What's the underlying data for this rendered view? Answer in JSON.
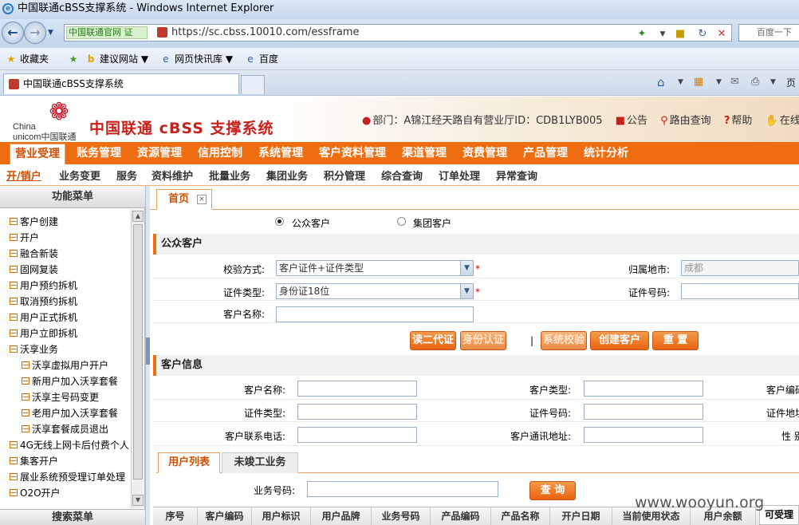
{
  "browser": {
    "window_title": "中国联通cBSS支撑系统 - Windows Internet Explorer",
    "site_tag": "中国联通官网 证",
    "url": "https://sc.cbss.10010.com/essframe",
    "search_placeholder": "百度一下",
    "favorites": {
      "favorites_label": "收藏夹",
      "suggested_sites": "建议网站",
      "web_slices": "网页快讯库",
      "baidu": "百度"
    },
    "tab_title": "中国联通cBSS支撑系统"
  },
  "app": {
    "system_title": "中国联通 cBSS 支撑系统",
    "logo_text_1": "China",
    "logo_text_2": "unicom中国联通",
    "user_info": {
      "dept": "部门：A锦江经天路自有营业厅ID：CDB1LYB005",
      "notice": "公告",
      "route_query": "路由查询",
      "help": "帮助",
      "online": "在线交"
    }
  },
  "main_menu": [
    "营业受理",
    "账务管理",
    "资源管理",
    "信用控制",
    "系统管理",
    "客户资料管理",
    "渠道管理",
    "资费管理",
    "产品管理",
    "统计分析"
  ],
  "sub_menu": [
    "开/销户",
    "业务变更",
    "服务",
    "资料维护",
    "批量业务",
    "集团业务",
    "积分管理",
    "综合查询",
    "订单处理",
    "异常查询"
  ],
  "left_panel": {
    "title": "功能菜单",
    "tree": [
      {
        "label": "客户创建",
        "level": 0
      },
      {
        "label": "开户",
        "level": 0
      },
      {
        "label": "融合新装",
        "level": 0
      },
      {
        "label": "固网复装",
        "level": 0
      },
      {
        "label": "用户预约拆机",
        "level": 0
      },
      {
        "label": "取消预约拆机",
        "level": 0
      },
      {
        "label": "用户正式拆机",
        "level": 0
      },
      {
        "label": "用户立即拆机",
        "level": 0
      },
      {
        "label": "沃享业务",
        "level": 0
      },
      {
        "label": "沃享虚拟用户开户",
        "level": 1
      },
      {
        "label": "新用户加入沃享套餐",
        "level": 1
      },
      {
        "label": "沃享主号码变更",
        "level": 1
      },
      {
        "label": "老用户加入沃享套餐",
        "level": 1
      },
      {
        "label": "沃享套餐成员退出",
        "level": 1
      },
      {
        "label": "4G无线上网卡后付费个人",
        "level": 0
      },
      {
        "label": "集客开户",
        "level": 0
      },
      {
        "label": "展业系统预受理订单处理",
        "level": 0
      },
      {
        "label": "O2O开户",
        "level": 0
      }
    ],
    "search_title": "搜索菜单"
  },
  "content": {
    "home_tab": "首页",
    "close_glyph": "×",
    "radios": {
      "public": "公众客户",
      "group": "集团客户"
    },
    "public_section": "公众客户",
    "verify_method_label": "校验方式:",
    "verify_method_value": "客户证件+证件类型",
    "region_label": "归属地市:",
    "region_value": "成都",
    "cert_type_label": "证件类型:",
    "cert_type_value": "身份证18位",
    "cert_no_label": "证件号码:",
    "cust_name_label": "客户名称:",
    "required_mark": "*",
    "buttons": {
      "read_id": "读二代证",
      "id_auth": "身份认证",
      "sys_verify": "系统校验",
      "create_cust": "创建客户",
      "reset": "重 置"
    },
    "cursor_mark": "|",
    "cust_info_section": "客户信息",
    "info_labels": {
      "cust_name": "客户名称:",
      "cust_type": "客户类型:",
      "cust_code": "客户编码",
      "cert_type": "证件类型:",
      "cert_no": "证件号码:",
      "cert_addr": "证件地址",
      "contact_phone": "客户联系电话:",
      "contact_addr": "客户通讯地址:",
      "gender": "性 别"
    },
    "sub_tabs": [
      "用户列表",
      "未竣工业务"
    ],
    "service_no_label": "业务号码:",
    "query_button": "查 询",
    "grid_headers": [
      "序号",
      "客户编码",
      "用户标识",
      "用户品牌",
      "业务号码",
      "产品编码",
      "产品名称",
      "开户日期",
      "当前使用状态",
      "用户余额",
      "可受理"
    ]
  },
  "watermark": "www.wooyun.org"
}
